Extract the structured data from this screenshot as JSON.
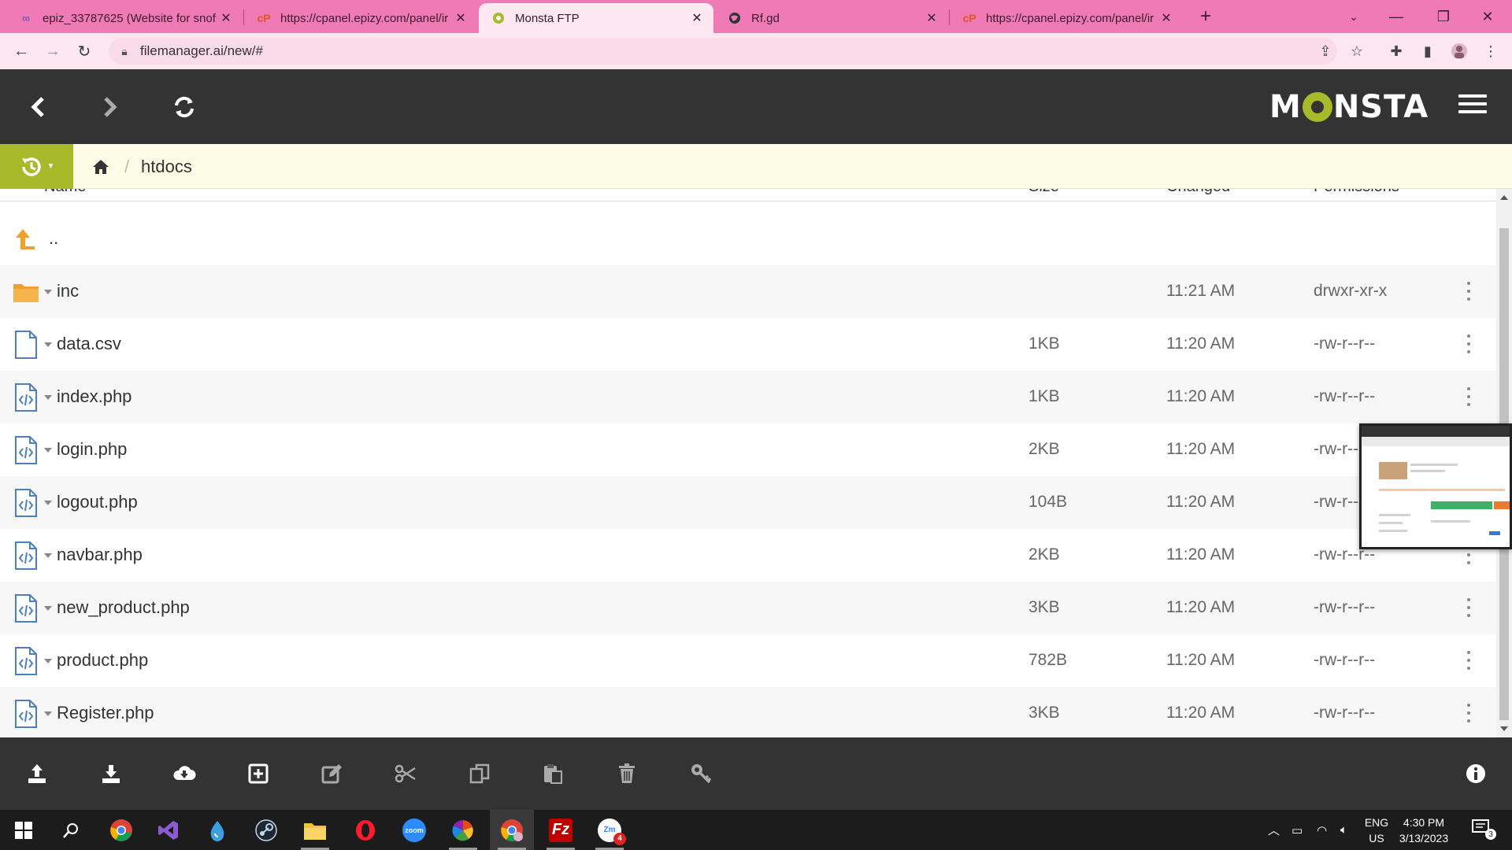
{
  "browser": {
    "tabs": [
      {
        "title": "epiz_33787625 (Website for snof",
        "icon": "infinity-icon",
        "active": false
      },
      {
        "title": "https://cpanel.epizy.com/panel/ir",
        "icon": "cpanel-icon",
        "active": false
      },
      {
        "title": "Monsta FTP",
        "icon": "monsta-icon",
        "active": true
      },
      {
        "title": "Rf.gd",
        "icon": "globe-icon",
        "active": false
      },
      {
        "title": "https://cpanel.epizy.com/panel/ir",
        "icon": "cpanel-icon",
        "active": false
      }
    ],
    "url": "filemanager.ai/new/#",
    "accent": "#f07ab6"
  },
  "app": {
    "logo": {
      "left": "M",
      "right": "NSTA"
    },
    "accent": "#a8b92a",
    "header_bg": "#333333"
  },
  "breadcrumb": {
    "separator": "/",
    "current": "htdocs"
  },
  "columns": {
    "name": "Name",
    "size": "Size",
    "changed": "Changed",
    "permissions": "Permissions"
  },
  "files": [
    {
      "name": "..",
      "type": "parent",
      "size": "",
      "changed": "",
      "permissions": ""
    },
    {
      "name": "inc",
      "type": "folder",
      "size": "",
      "changed": "11:21 AM",
      "permissions": "drwxr-xr-x"
    },
    {
      "name": "data.csv",
      "type": "file",
      "size": "1KB",
      "changed": "11:20 AM",
      "permissions": "-rw-r--r--"
    },
    {
      "name": "index.php",
      "type": "code",
      "size": "1KB",
      "changed": "11:20 AM",
      "permissions": "-rw-r--r--"
    },
    {
      "name": "login.php",
      "type": "code",
      "size": "2KB",
      "changed": "11:20 AM",
      "permissions": "-rw-r--r--"
    },
    {
      "name": "logout.php",
      "type": "code",
      "size": "104B",
      "changed": "11:20 AM",
      "permissions": "-rw-r--r--"
    },
    {
      "name": "navbar.php",
      "type": "code",
      "size": "2KB",
      "changed": "11:20 AM",
      "permissions": "-rw-r--r--"
    },
    {
      "name": "new_product.php",
      "type": "code",
      "size": "3KB",
      "changed": "11:20 AM",
      "permissions": "-rw-r--r--"
    },
    {
      "name": "product.php",
      "type": "code",
      "size": "782B",
      "changed": "11:20 AM",
      "permissions": "-rw-r--r--"
    },
    {
      "name": "Register.php",
      "type": "code",
      "size": "3KB",
      "changed": "11:20 AM",
      "permissions": "-rw-r--r--"
    }
  ],
  "actions": [
    "upload-icon",
    "download-icon",
    "cloud-download-icon",
    "new-item-icon",
    "edit-icon",
    "cut-icon",
    "copy-icon",
    "paste-icon",
    "trash-icon",
    "key-icon",
    "info-icon"
  ],
  "taskbar": {
    "apps": [
      "windows-start-icon",
      "search-icon",
      "chrome-icon",
      "visual-studio-icon",
      "drop-icon",
      "steam-icon",
      "file-explorer-icon",
      "opera-icon",
      "zoom-icon",
      "pinwheel-icon",
      "chrome-icon",
      "filezilla-icon",
      "zoom-chat-icon"
    ],
    "zoom_label": "zoom",
    "zoom_chat_badge": "4",
    "lang_line1": "ENG",
    "lang_line2": "US",
    "time": "4:30 PM",
    "date": "3/13/2023",
    "notifications": "3"
  }
}
